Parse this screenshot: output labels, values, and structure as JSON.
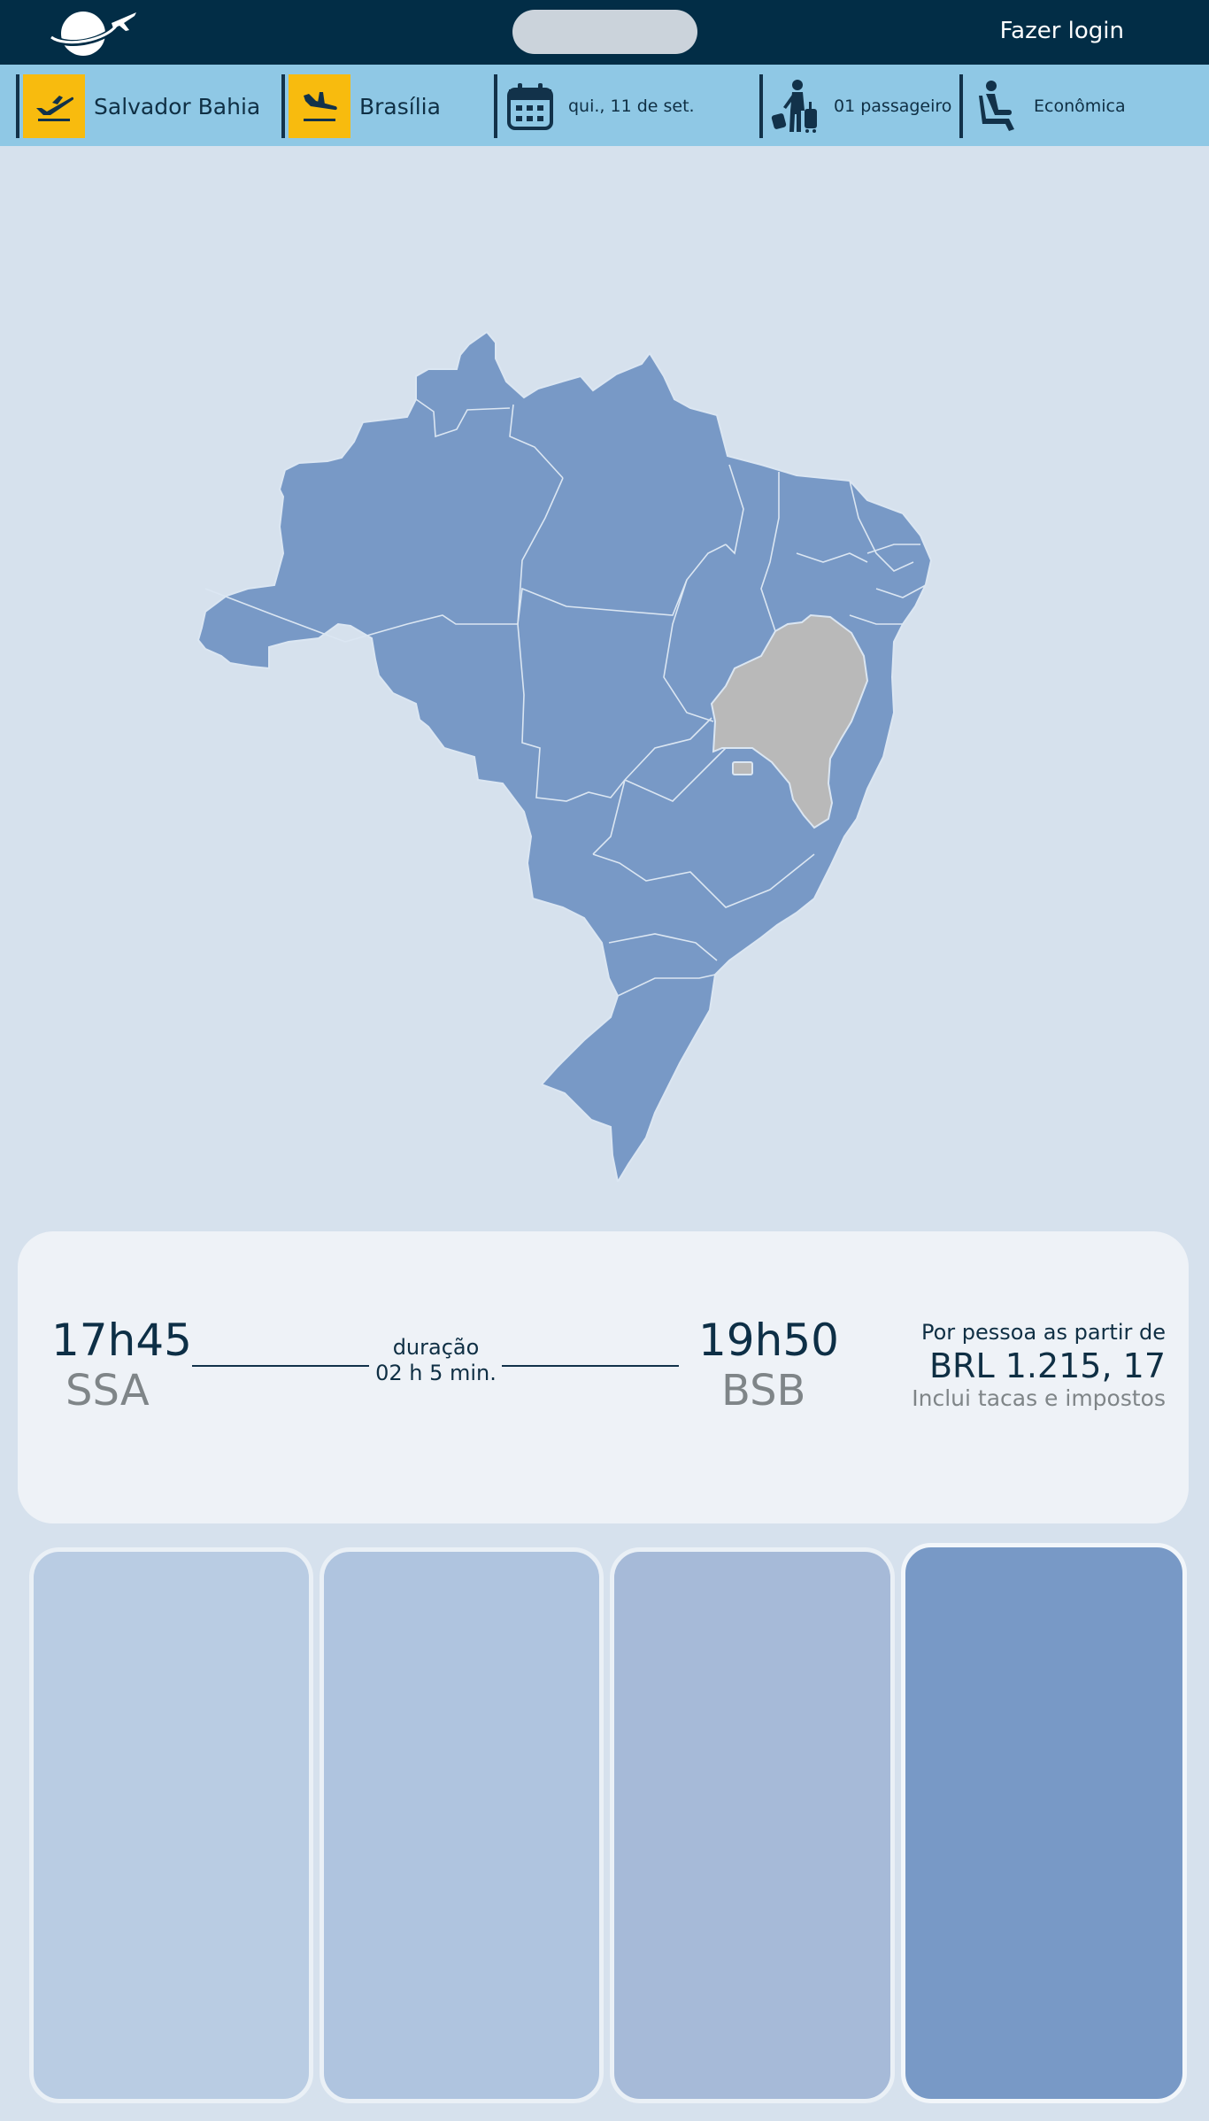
{
  "header": {
    "logo": "planet-plane-logo",
    "login_label": "Fazer login"
  },
  "search": {
    "origin": "Salvador Bahia",
    "destination": "Brasília",
    "date": "qui., 11 de set.",
    "passengers": "01 passageiro",
    "cabin": "Econômica"
  },
  "map": {
    "country": "brazil-map",
    "highlighted_state": "Bahia",
    "base_color": "#7899c6",
    "highlight_color": "#b9b9b9"
  },
  "flight": {
    "depart_time": "17h45",
    "depart_code": "SSA",
    "duration_label": "duração",
    "duration_value": "02 h 5 min.",
    "arrive_time": "19h50",
    "arrive_code": "BSB",
    "price_label": "Por pessoa as partir de",
    "price_value": "BRL 1.215, 17",
    "price_note": "Inclui tacas e impostos"
  },
  "colors": {
    "topbar": "#022d46",
    "criteria_bar": "#8fc8e5",
    "accent_yellow": "#f8bb0e",
    "background": "#d6e1ed"
  },
  "fare_options": [
    {
      "color": "#b9cce3"
    },
    {
      "color": "#afc4df"
    },
    {
      "color": "#a6bad8"
    },
    {
      "color": "#7899c6"
    }
  ]
}
